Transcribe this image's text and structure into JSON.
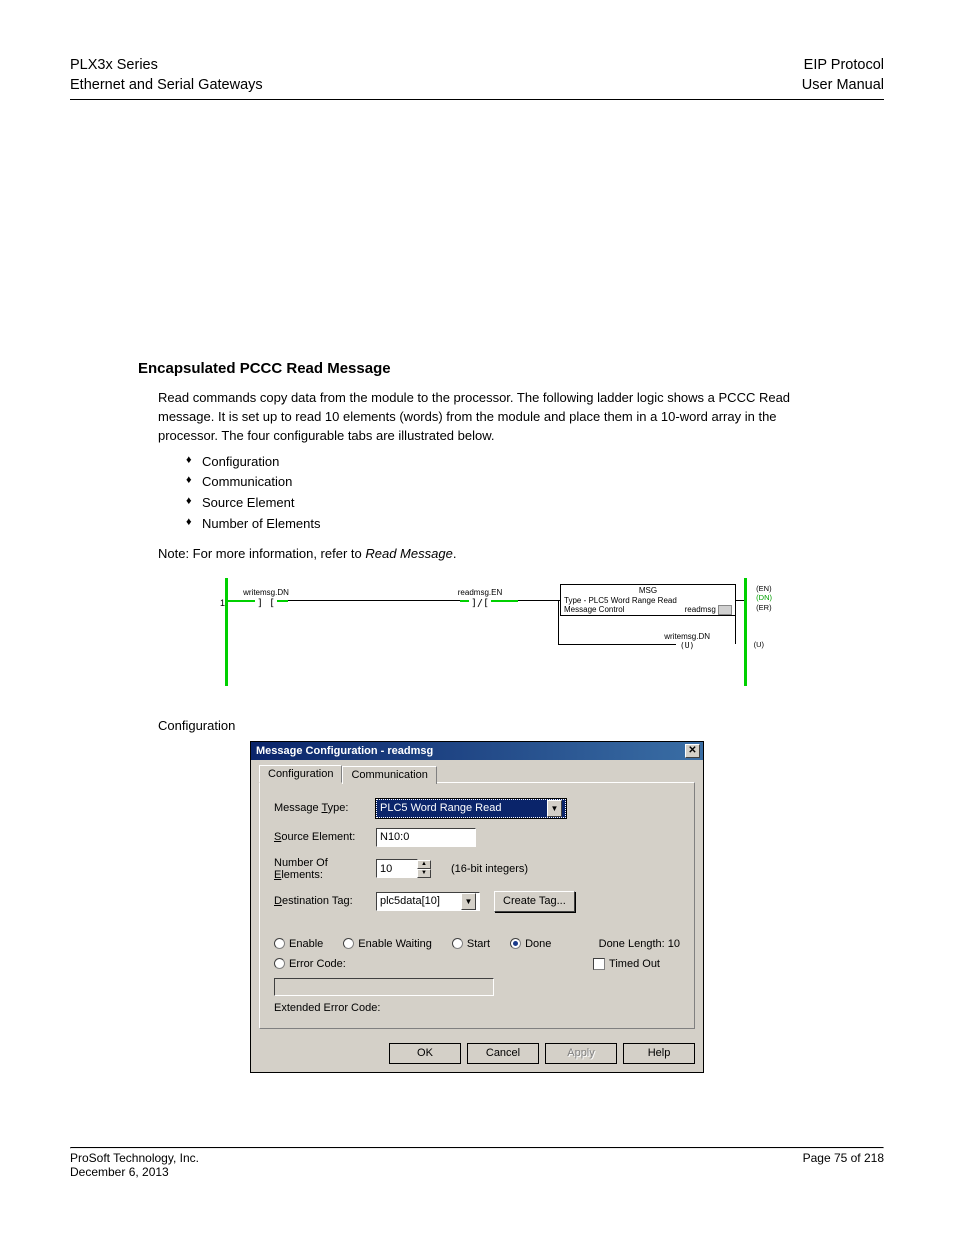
{
  "header": {
    "left_line1": "PLX3x Series",
    "left_line2": "Ethernet and Serial Gateways",
    "right_line1": "EIP Protocol",
    "right_line2": "User Manual"
  },
  "section": {
    "heading": "Encapsulated PCCC Read Message",
    "intro": "Read commands copy data from the module to the processor. The following ladder logic shows a PCCC Read message. It is set up to read 10 elements (words) from the module and place them in a 10-word array in the processor. The four configurable tabs are illustrated below.",
    "bullets": [
      "Configuration",
      "Communication",
      "Source Element",
      "Number of Elements"
    ],
    "note_prefix": "Note: For more information, refer to ",
    "note_italic": "Read Message"
  },
  "ladder": {
    "rung": "1",
    "contact1": "writemsg.DN",
    "contact1_sym": "] [",
    "contact2": "readmsg.EN",
    "contact2_sym": "]/[",
    "msg_title": "MSG",
    "msg_line1_label": "Type - PLC5 Word Range Read",
    "msg_line2_label": "Message Control",
    "msg_line2_val": "readmsg",
    "flags": {
      "en": "(EN)",
      "dn": "(DN)",
      "er": "(ER)"
    },
    "branch_label": "writemsg.DN",
    "branch_sym": "(U)"
  },
  "caption": "Configuration",
  "dialog": {
    "title": "Message Configuration - readmsg",
    "tabs": {
      "active": "Configuration",
      "inactive": "Communication"
    },
    "fields": {
      "msg_type_label": "Message Type:",
      "msg_type_value": "PLC5 Word Range Read",
      "src_label": "Source Element:",
      "src_value": "N10:0",
      "num_label": "Number Of Elements:",
      "num_value": "10",
      "num_unit": "(16-bit integers)",
      "dest_label": "Destination Tag:",
      "dest_value": "plc5data[10]",
      "create_tag": "Create Tag..."
    },
    "status": {
      "enable": "Enable",
      "enable_waiting": "Enable Waiting",
      "start": "Start",
      "done": "Done",
      "done_len_label": "Done Length:",
      "done_len_val": "10",
      "error_code": "Error Code:",
      "timed_out": "Timed Out",
      "extended": "Extended Error Code:"
    },
    "buttons": {
      "ok": "OK",
      "cancel": "Cancel",
      "apply": "Apply",
      "help": "Help"
    }
  },
  "footer": {
    "left_line1": "ProSoft Technology, Inc.",
    "left_line2": "December 6, 2013",
    "right_line1": "Page 75 of 218"
  }
}
